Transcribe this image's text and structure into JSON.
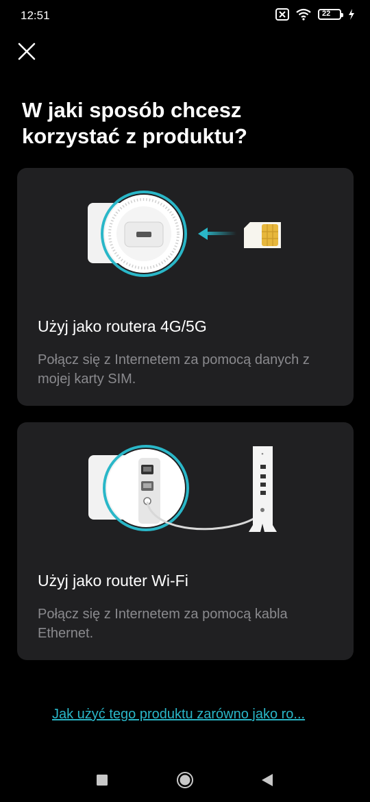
{
  "status_bar": {
    "time": "12:51",
    "battery_level": "22",
    "icons": [
      "sim-off-icon",
      "wifi-icon",
      "battery-icon",
      "charging-icon"
    ]
  },
  "header": {
    "close_icon": "close-icon",
    "title": "W jaki sposób chcesz korzystać z produktu?"
  },
  "options": [
    {
      "title": "Użyj jako routera 4G/5G",
      "description": "Połącz się z Internetem za pomocą danych z mojej karty SIM.",
      "illustration": "sim-router-illustration"
    },
    {
      "title": "Użyj jako router Wi-Fi",
      "description": "Połącz się z Internetem za pomocą kabla Ethernet.",
      "illustration": "ethernet-router-illustration"
    }
  ],
  "footer": {
    "link": "Jak użyć tego produktu zarówno jako ro..."
  },
  "nav_bar": {
    "icons": [
      "recents-icon",
      "home-icon",
      "back-icon"
    ]
  },
  "colors": {
    "background": "#000000",
    "card": "#202022",
    "accent": "#2ab7c8",
    "secondary_text": "#8a8a8e"
  }
}
